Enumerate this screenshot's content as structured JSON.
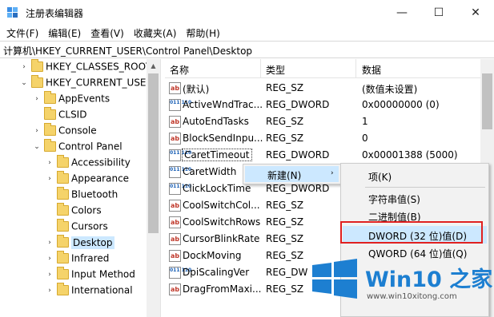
{
  "window": {
    "title": "注册表编辑器",
    "min": "—",
    "max": "☐",
    "close": "✕"
  },
  "menubar": [
    "文件(F)",
    "编辑(E)",
    "查看(V)",
    "收藏夹(A)",
    "帮助(H)"
  ],
  "address": "计算机\\HKEY_CURRENT_USER\\Control Panel\\Desktop",
  "tree": [
    {
      "label": "HKEY_CLASSES_ROOT",
      "twisty": "›"
    },
    {
      "label": "HKEY_CURRENT_USER",
      "twisty": "⌄"
    },
    {
      "label": "AppEvents",
      "twisty": "›"
    },
    {
      "label": "CLSID",
      "twisty": ""
    },
    {
      "label": "Console",
      "twisty": "›"
    },
    {
      "label": "Control Panel",
      "twisty": "⌄"
    },
    {
      "label": "Accessibility",
      "twisty": "›"
    },
    {
      "label": "Appearance",
      "twisty": "›"
    },
    {
      "label": "Bluetooth",
      "twisty": ""
    },
    {
      "label": "Colors",
      "twisty": ""
    },
    {
      "label": "Cursors",
      "twisty": ""
    },
    {
      "label": "Desktop",
      "twisty": "›"
    },
    {
      "label": "Infrared",
      "twisty": "›"
    },
    {
      "label": "Input Method",
      "twisty": "›"
    },
    {
      "label": "International",
      "twisty": "›"
    }
  ],
  "columns": {
    "name": "名称",
    "type": "类型",
    "data": "数据"
  },
  "rows": [
    {
      "name": "(默认)",
      "type": "REG_SZ",
      "data": "(数值未设置)",
      "icon": "string-value-icon"
    },
    {
      "name": "ActiveWndTrac...",
      "type": "REG_DWORD",
      "data": "0x00000000 (0)",
      "icon": "binary-value-icon"
    },
    {
      "name": "AutoEndTasks",
      "type": "REG_SZ",
      "data": "1",
      "icon": "string-value-icon"
    },
    {
      "name": "BlockSendInpu...",
      "type": "REG_SZ",
      "data": "0",
      "icon": "string-value-icon"
    },
    {
      "name": "CaretTimeout",
      "type": "REG_DWORD",
      "data": "0x00001388 (5000)",
      "icon": "binary-value-icon"
    },
    {
      "name": "CaretWidth",
      "type": "",
      "data": "",
      "icon": "binary-value-icon"
    },
    {
      "name": "ClickLockTime",
      "type": "REG_DWORD",
      "data": "",
      "icon": "binary-value-icon"
    },
    {
      "name": "CoolSwitchCol...",
      "type": "REG_SZ",
      "data": "",
      "icon": "string-value-icon"
    },
    {
      "name": "CoolSwitchRows",
      "type": "REG_SZ",
      "data": "",
      "icon": "string-value-icon"
    },
    {
      "name": "CursorBlinkRate",
      "type": "REG_SZ",
      "data": "",
      "icon": "string-value-icon"
    },
    {
      "name": "DockMoving",
      "type": "REG_SZ",
      "data": "",
      "icon": "string-value-icon"
    },
    {
      "name": "DpiScalingVer",
      "type": "REG_DW",
      "data": "",
      "icon": "binary-value-icon"
    },
    {
      "name": "DragFromMaxi...",
      "type": "REG_SZ",
      "data": "",
      "icon": "string-value-icon"
    }
  ],
  "context_menu": {
    "new_label": "新建(N)",
    "arrow": "›"
  },
  "submenu": [
    "项(K)",
    "字符串值(S)",
    "二进制值(B)",
    "DWORD (32 位)值(D)",
    "QWORD (64 位)值(Q)"
  ],
  "watermark": {
    "title": "Win10 之家",
    "url": "www.win10xitong.com"
  },
  "colors": {
    "selection": "#cce8ff",
    "highlight_box": "#e02020",
    "brand": "#1d7fd1"
  }
}
